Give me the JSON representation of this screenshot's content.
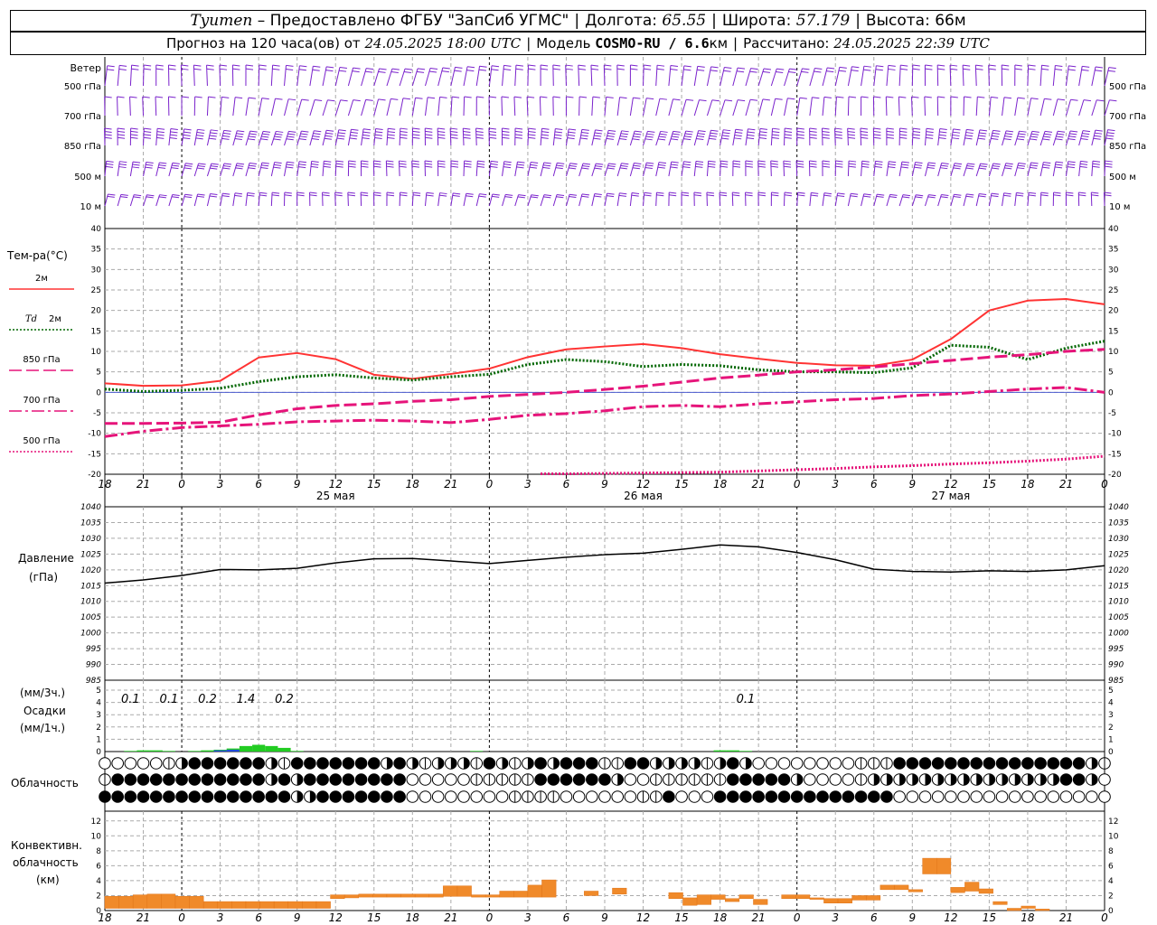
{
  "header": {
    "station": "Tyumen",
    "provider": "– Предоставлено ФГБУ \"ЗапСиб УГМС\"",
    "lon_label": "Долгота:",
    "lon": "65.55",
    "lat_label": "Широта:",
    "lat": "57.179",
    "alt_label": "Высота:",
    "alt": "66м",
    "forecast_prefix": "Прогноз на 120 часа(ов) от",
    "forecast_start": "24.05.2025 18:00 UTC",
    "model_label": "Модель",
    "model": "COSMO-RU / 6.6",
    "model_unit": "км",
    "calc_label": "Рассчитано:",
    "calc_time": "24.05.2025 22:39 UTC"
  },
  "colors": {
    "t2m": "#ff3333",
    "td2m": "#006600",
    "levels": "#e6147a",
    "pressure": "#000000",
    "wind": "#7a22cc",
    "conv": "#f08a2a",
    "precip_green": "#22cc22",
    "precip_blue": "#1e4cd8"
  },
  "chart_data": [
    {
      "type": "wind_barbs",
      "title": "Ветер",
      "levels": [
        "500 гПа",
        "700 гПа",
        "850 гПа",
        "500 м",
        "10 м"
      ]
    },
    {
      "type": "line",
      "ylabel": "Тем-ра(°C)",
      "ylim": [
        -20,
        40
      ],
      "yticks": [
        40,
        35,
        30,
        25,
        20,
        15,
        10,
        5,
        0,
        -5,
        -10,
        -15,
        -20
      ],
      "xlim": [
        0,
        78
      ],
      "x_unit": "hours from 24.05 18 UTC",
      "series": [
        {
          "name": "2м",
          "style": "solid",
          "color": "#ff3333",
          "x": [
            0,
            3,
            6,
            9,
            12,
            15,
            18,
            21,
            24,
            27,
            30,
            33,
            36,
            39,
            42,
            45,
            48,
            51,
            54,
            57,
            60,
            63,
            66,
            69,
            72,
            75,
            78
          ],
          "y": [
            2.2,
            1.6,
            1.7,
            2.8,
            8.5,
            9.6,
            8.1,
            4.3,
            3.3,
            4.5,
            5.8,
            8.6,
            10.5,
            11.2,
            11.8,
            10.8,
            9.3,
            8.2,
            7.2,
            6.6,
            6.5,
            8.0,
            13.0,
            20.0,
            22.4,
            22.8,
            21.5
          ]
        },
        {
          "name": "Td 2м",
          "label_prefix": "Td",
          "label_suffix": "2м",
          "style": "dotted",
          "color": "#006600",
          "x": [
            0,
            3,
            6,
            9,
            12,
            15,
            18,
            21,
            24,
            27,
            30,
            33,
            36,
            39,
            42,
            45,
            48,
            51,
            54,
            57,
            60,
            63,
            66,
            69,
            72,
            75,
            78
          ],
          "y": [
            0.8,
            0.2,
            0.5,
            1.0,
            2.6,
            3.8,
            4.3,
            3.5,
            3.0,
            3.8,
            4.4,
            6.8,
            8.0,
            7.5,
            6.3,
            6.8,
            6.5,
            5.5,
            5.0,
            5.0,
            4.8,
            6.0,
            11.5,
            11.0,
            8.0,
            10.8,
            12.5
          ]
        },
        {
          "name": "850 гПа",
          "style": "longdash",
          "color": "#e6147a",
          "x": [
            0,
            3,
            6,
            9,
            12,
            15,
            18,
            21,
            24,
            27,
            30,
            33,
            36,
            39,
            42,
            45,
            48,
            51,
            54,
            57,
            60,
            63,
            66,
            69,
            72,
            75,
            78
          ],
          "y": [
            -7.6,
            -7.6,
            -7.5,
            -7.3,
            -5.5,
            -4.0,
            -3.2,
            -2.8,
            -2.2,
            -1.8,
            -1.0,
            -0.5,
            0.0,
            0.7,
            1.5,
            2.5,
            3.5,
            4.2,
            5.0,
            5.5,
            6.2,
            7.0,
            7.8,
            8.6,
            9.2,
            10.0,
            10.5
          ]
        },
        {
          "name": "700 гПа",
          "style": "dashdot",
          "color": "#e6147a",
          "x": [
            0,
            3,
            6,
            9,
            12,
            15,
            18,
            21,
            24,
            27,
            30,
            33,
            36,
            39,
            42,
            45,
            48,
            51,
            54,
            57,
            60,
            63,
            66,
            69,
            72,
            75,
            78
          ],
          "y": [
            -10.8,
            -9.5,
            -8.6,
            -8.2,
            -7.8,
            -7.2,
            -7.0,
            -6.8,
            -7.0,
            -7.4,
            -6.6,
            -5.6,
            -5.2,
            -4.5,
            -3.5,
            -3.2,
            -3.5,
            -2.8,
            -2.3,
            -1.8,
            -1.5,
            -0.8,
            -0.4,
            0.2,
            0.8,
            1.2,
            0.0
          ]
        },
        {
          "name": "500 гПа",
          "style": "dotted",
          "color": "#e6147a",
          "x": [
            34,
            36,
            39,
            42,
            45,
            48,
            51,
            54,
            57,
            60,
            63,
            66,
            69,
            72,
            75,
            78
          ],
          "y": [
            -19.9,
            -19.9,
            -19.8,
            -19.7,
            -19.6,
            -19.5,
            -19.2,
            -18.9,
            -18.6,
            -18.2,
            -17.9,
            -17.5,
            -17.2,
            -16.8,
            -16.3,
            -15.6
          ]
        }
      ]
    },
    {
      "type": "line",
      "ylabel": "Давление",
      "ylabel2": "(гПа)",
      "ylim": [
        985,
        1040
      ],
      "yticks": [
        1040,
        1035,
        1030,
        1025,
        1020,
        1015,
        1010,
        1005,
        1000,
        995,
        990,
        985
      ],
      "series": [
        {
          "name": "pressure",
          "color": "#000000",
          "x": [
            0,
            3,
            6,
            9,
            12,
            15,
            18,
            21,
            24,
            27,
            30,
            33,
            36,
            39,
            42,
            45,
            48,
            51,
            54,
            57,
            60,
            63,
            66,
            69,
            72,
            75,
            78
          ],
          "y": [
            1015.8,
            1016.8,
            1018.2,
            1020.1,
            1020.0,
            1020.5,
            1022.2,
            1023.5,
            1023.6,
            1022.8,
            1022.0,
            1023.0,
            1024.0,
            1024.8,
            1025.3,
            1026.5,
            1027.9,
            1027.3,
            1025.5,
            1023.2,
            1020.2,
            1019.5,
            1019.3,
            1019.7,
            1019.5,
            1020.0,
            1021.3
          ]
        }
      ]
    },
    {
      "type": "bar",
      "ylabel_top": "(мм/3ч.)",
      "ylabel": "Осадки",
      "ylabel_bottom": "(мм/1ч.)",
      "ylim": [
        0,
        5
      ],
      "yticks": [
        5,
        4,
        3,
        2,
        1,
        0
      ],
      "accum_labels": [
        {
          "t": 2,
          "text": "0.1"
        },
        {
          "t": 5,
          "text": "0.1"
        },
        {
          "t": 8,
          "text": "0.2"
        },
        {
          "t": 11,
          "text": "1.4"
        },
        {
          "t": 14,
          "text": "0.2"
        },
        {
          "t": 50,
          "text": "0.1"
        }
      ],
      "x": [
        2,
        3,
        4,
        5,
        6,
        7,
        8,
        9,
        10,
        11,
        12,
        13,
        14,
        15,
        29,
        48,
        49,
        50
      ],
      "values": [
        0.05,
        0.1,
        0.1,
        0.05,
        0.0,
        0.05,
        0.1,
        0.15,
        0.25,
        0.45,
        0.55,
        0.45,
        0.3,
        0.05,
        0.05,
        0.1,
        0.1,
        0.05
      ],
      "blue_x": [
        9,
        10
      ],
      "blue_values": [
        0.1,
        0.15
      ]
    },
    {
      "type": "table",
      "title": "Облачность",
      "rows": [
        "0000012333333213333333232122213212323331133222212320000000011133333333333333321",
        "1333333333333232333333330000011111333333200111111333332000012222222222222223320",
        "3333333333333332233333330000000011110000001130003333333333333300000000000000000"
      ]
    },
    {
      "type": "bar",
      "ylabel": "Конвективн.",
      "ylabel2": "облачность",
      "ylabel3": "(км)",
      "ylim": [
        0,
        12
      ],
      "yticks": [
        12,
        10,
        8,
        6,
        4,
        2,
        0
      ],
      "bases": [
        0.3,
        0.3,
        0.3,
        0.3,
        0.3,
        0.3,
        0.3,
        0.3,
        0.3,
        0.3,
        0.3,
        0.3,
        0.3,
        0.3,
        0.3,
        0.3,
        1.6,
        1.7,
        1.8,
        1.8,
        1.8,
        1.8,
        1.8,
        1.8,
        1.9,
        1.9,
        1.8,
        1.8,
        1.8,
        1.8,
        1.8,
        1.8,
        2.6,
        2.6,
        2.0,
        2.0,
        2.2,
        3.4,
        2.5,
        1.9,
        1.6,
        0.7,
        0.8,
        1.5,
        1.2,
        1.6,
        0.8,
        1.6,
        1.6,
        1.6,
        1.5,
        1.0,
        1.0,
        1.4,
        1.4,
        2.8,
        2.8,
        2.5,
        4.9,
        4.9,
        2.4,
        2.6,
        2.3,
        0.8,
        0.0,
        0.3,
        0.0
      ],
      "tops": [
        1.9,
        1.9,
        2.1,
        2.2,
        2.2,
        1.9,
        1.9,
        1.2,
        1.2,
        1.2,
        1.2,
        1.2,
        1.2,
        1.2,
        1.2,
        1.2,
        2.1,
        2.1,
        2.2,
        2.2,
        2.2,
        2.2,
        2.2,
        2.2,
        3.3,
        3.3,
        2.1,
        2.1,
        2.6,
        2.6,
        3.4,
        4.1,
        2.6,
        2.6,
        2.6,
        1.8,
        3.0,
        3.4,
        2.5,
        1.9,
        2.4,
        1.7,
        2.1,
        2.1,
        1.6,
        2.1,
        1.5,
        1.6,
        2.1,
        2.1,
        1.7,
        1.6,
        1.6,
        2.0,
        2.0,
        3.4,
        3.4,
        2.8,
        7.0,
        7.0,
        3.1,
        3.8,
        2.9,
        1.2,
        0.3,
        0.6,
        0.2
      ]
    },
    {
      "type": "axis",
      "x_tick_labels": [
        "18",
        "21",
        "0",
        "3",
        "6",
        "9",
        "12",
        "15",
        "18",
        "21",
        "0",
        "3",
        "6",
        "9",
        "12",
        "15",
        "18",
        "21",
        "0",
        "3",
        "6",
        "9",
        "12",
        "15",
        "18",
        "21",
        "0"
      ],
      "day_labels": [
        {
          "t": 18,
          "text": "25 мая"
        },
        {
          "t": 42,
          "text": "26 мая"
        },
        {
          "t": 66,
          "text": "27 мая"
        }
      ]
    }
  ]
}
